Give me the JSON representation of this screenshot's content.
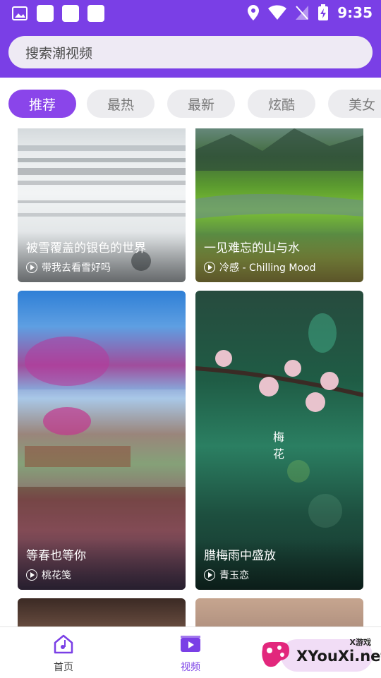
{
  "status": {
    "time": "9:35"
  },
  "search": {
    "placeholder": "搜索潮视频"
  },
  "tabs": [
    {
      "label": "推荐",
      "active": true
    },
    {
      "label": "最热"
    },
    {
      "label": "最新"
    },
    {
      "label": "炫酷"
    },
    {
      "label": "美女"
    }
  ],
  "cards": [
    {
      "title": "被雪覆盖的银色的世界",
      "meta": "带我去看雪好吗"
    },
    {
      "title": "一见难忘的山与水",
      "meta": "冷感 - Chilling Mood"
    },
    {
      "title": "等春也等你",
      "meta": "桃花笺"
    },
    {
      "title": "腊梅雨中盛放",
      "meta": "青玉恋",
      "overlay": "梅 花"
    }
  ],
  "nav": [
    {
      "label": "首页",
      "icon": "home-icon"
    },
    {
      "label": "视频",
      "icon": "video-icon",
      "active": true
    }
  ],
  "watermark": {
    "brand": "XYouXi.net",
    "tag": "X游戏"
  },
  "colors": {
    "accent": "#7a3fe6",
    "tab_active": "#8a45ea"
  }
}
